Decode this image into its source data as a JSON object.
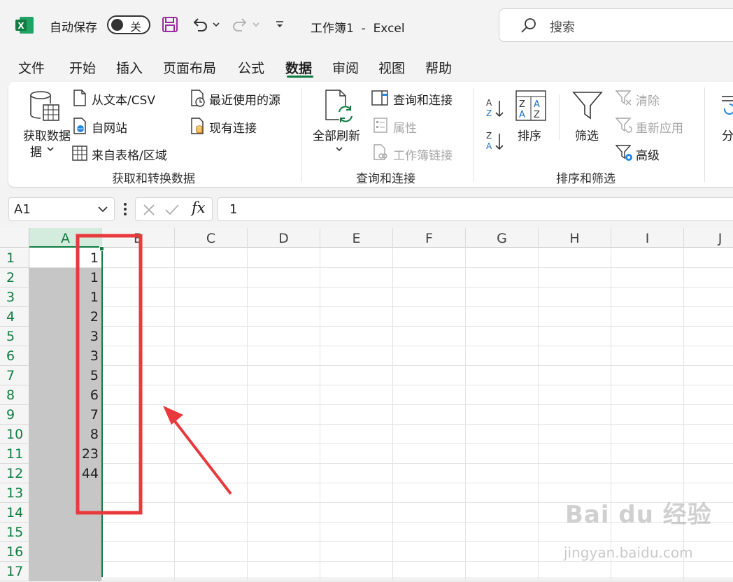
{
  "titlebar": {
    "autosave_label": "自动保存",
    "autosave_state": "关",
    "doc_title": "工作簿1  -  Excel",
    "search_placeholder": "搜索"
  },
  "menu": {
    "tabs": [
      "文件",
      "开始",
      "插入",
      "页面布局",
      "公式",
      "数据",
      "审阅",
      "视图",
      "帮助"
    ],
    "active": "数据"
  },
  "ribbon": {
    "get_data": "获取数据",
    "get_data_2": "据",
    "from_text": "从文本/CSV",
    "from_web": "自网站",
    "from_table": "来自表格/区域",
    "recent_sources": "最近使用的源",
    "existing_connections": "现有连接",
    "group1": "获取和转换数据",
    "refresh_all": "全部刷新",
    "queries_connections": "查询和连接",
    "properties": "属性",
    "workbook_links": "工作簿链接",
    "group2": "查询和连接",
    "sort": "排序",
    "filter": "筛选",
    "clear": "清除",
    "reapply": "重新应用",
    "advanced": "高级",
    "group3": "排序和筛选",
    "split": "分"
  },
  "formula_bar": {
    "name_box": "A1",
    "fx": "fx",
    "formula": "1"
  },
  "grid": {
    "columns": [
      "A",
      "B",
      "C",
      "D",
      "E",
      "F",
      "G",
      "H",
      "I",
      "J"
    ],
    "rows": [
      "1",
      "2",
      "3",
      "4",
      "5",
      "6",
      "7",
      "8",
      "9",
      "10",
      "11",
      "12",
      "13",
      "14",
      "15",
      "16",
      "17"
    ],
    "column_a_values": [
      "1",
      "1",
      "1",
      "2",
      "3",
      "3",
      "5",
      "6",
      "7",
      "8",
      "23",
      "44"
    ]
  },
  "watermark": {
    "brand": "Bai du 经验",
    "url": "jingyan.baidu.com"
  },
  "colors": {
    "excel_green": "#107c41",
    "selection_gray": "#c6c6c6",
    "annotation_red": "#e8393c"
  }
}
